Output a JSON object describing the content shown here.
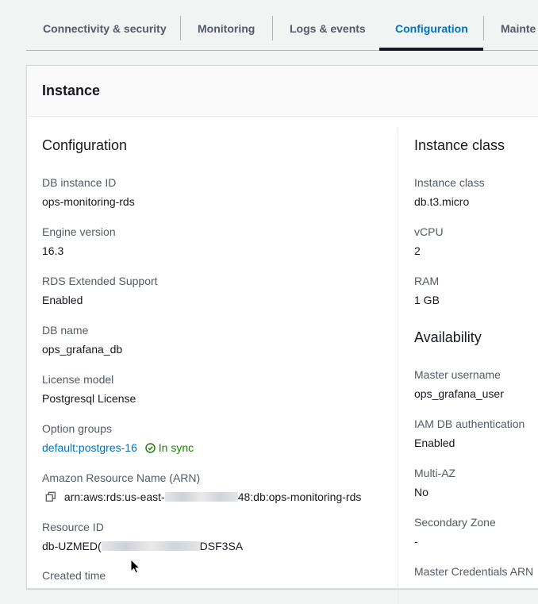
{
  "tabs": [
    {
      "label": "Connectivity & security"
    },
    {
      "label": "Monitoring"
    },
    {
      "label": "Logs & events"
    },
    {
      "label": "Configuration"
    },
    {
      "label": "Mainte"
    }
  ],
  "active_tab": "Configuration",
  "panel": {
    "title": "Instance"
  },
  "configuration": {
    "heading": "Configuration",
    "db_instance_id": {
      "label": "DB instance ID",
      "value": "ops-monitoring-rds"
    },
    "engine_version": {
      "label": "Engine version",
      "value": "16.3"
    },
    "rds_extended_support": {
      "label": "RDS Extended Support",
      "value": "Enabled"
    },
    "db_name": {
      "label": "DB name",
      "value": "ops_grafana_db"
    },
    "license_model": {
      "label": "License model",
      "value": "Postgresql License"
    },
    "option_groups": {
      "label": "Option groups",
      "value": "default:postgres-16",
      "status": "In sync"
    },
    "arn": {
      "label": "Amazon Resource Name (ARN)",
      "prefix": "arn:aws:rds:us-east-",
      "suffix": "48:db:ops-monitoring-rds"
    },
    "resource_id": {
      "label": "Resource ID",
      "prefix": "db-UZMED(",
      "suffix": "DSF3SA"
    },
    "next_label": "Created time"
  },
  "instance_class": {
    "heading": "Instance class",
    "instance_class": {
      "label": "Instance class",
      "value": "db.t3.micro"
    },
    "vcpu": {
      "label": "vCPU",
      "value": "2"
    },
    "ram": {
      "label": "RAM",
      "value": "1 GB"
    }
  },
  "availability": {
    "heading": "Availability",
    "master_username": {
      "label": "Master username",
      "value": "ops_grafana_user"
    },
    "iam_auth": {
      "label": "IAM DB authentication",
      "value": "Enabled"
    },
    "multi_az": {
      "label": "Multi-AZ",
      "value": "No"
    },
    "secondary_zone": {
      "label": "Secondary Zone",
      "value": "-"
    },
    "master_credentials_arn": {
      "label": "Master Credentials ARN"
    }
  },
  "colors": {
    "accent": "#0073bb",
    "success": "#1d8102",
    "text": "#16191f",
    "label": "#545b64"
  }
}
